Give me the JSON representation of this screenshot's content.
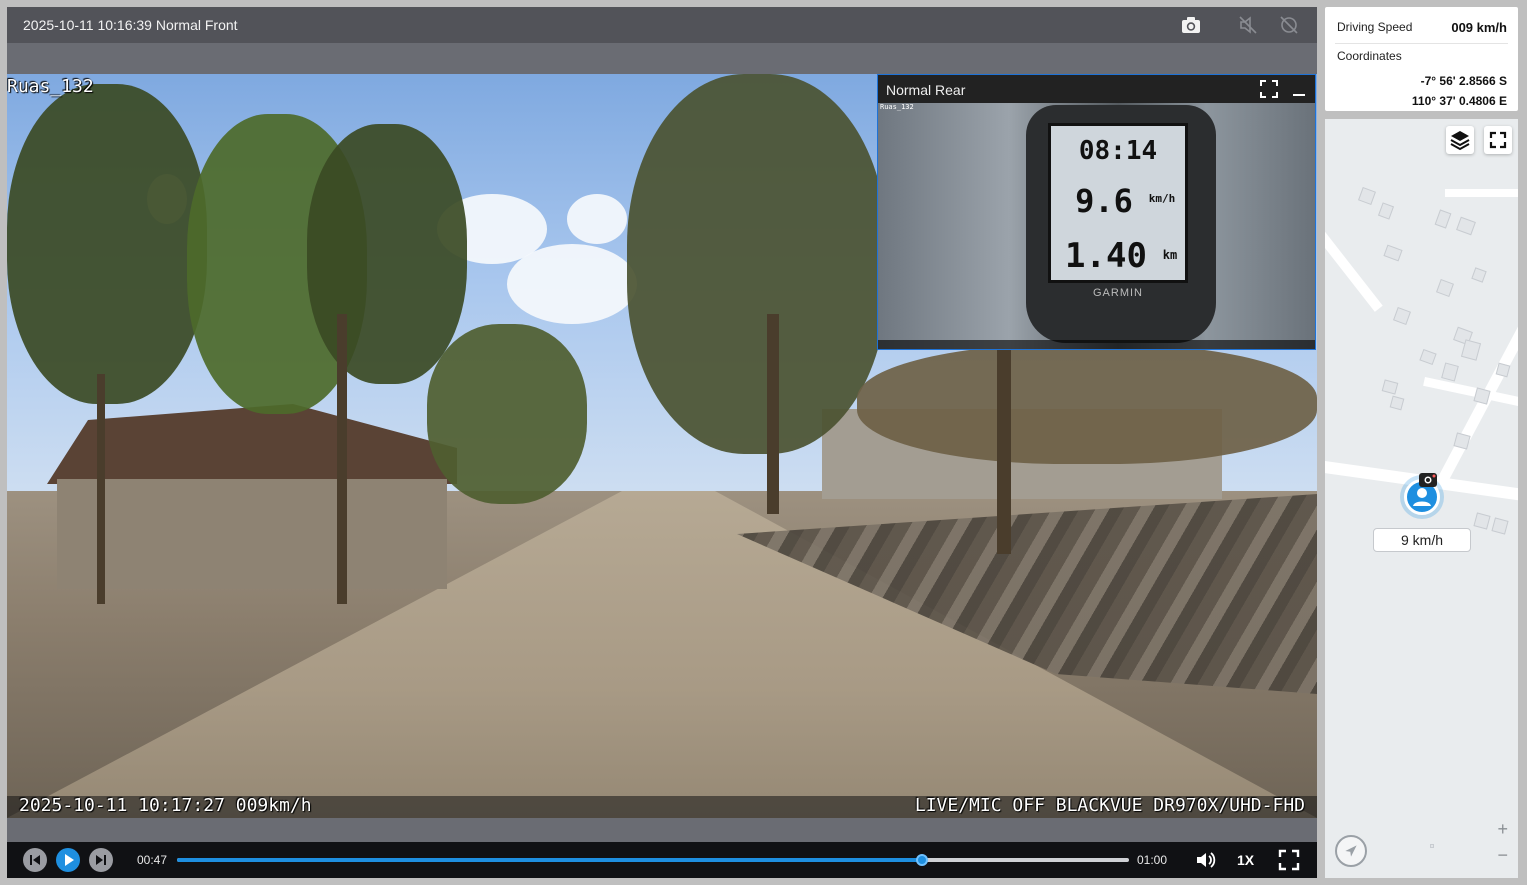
{
  "player": {
    "title": "2025-10-11 10:16:39 Normal Front",
    "icons": [
      "camera-icon",
      "no-audio-icon",
      "no-gps-icon"
    ],
    "osd": {
      "top_left": "Ruas_132",
      "bottom_left": "2025-10-11 10:17:27 009km/h",
      "bottom_right": "LIVE/MIC OFF BLACKVUE DR970X/UHD-FHD"
    },
    "pip": {
      "title": "Normal Rear",
      "osd_top": "Ruas_132",
      "gps": {
        "line1": "08:14",
        "line2": "9.6",
        "line2_unit": "km/h",
        "line3": "1.40",
        "line3_unit": "km",
        "brand": "GARMIN"
      }
    },
    "controls": {
      "current_time": "00:47",
      "total_time": "01:00",
      "progress": 0.783,
      "playback_speed": "1X"
    }
  },
  "info": {
    "speed_label": "Driving Speed",
    "speed_value": "009 km/h",
    "coords_label": "Coordinates",
    "lat": "-7° 56' 2.8566 S",
    "lon": "110° 37' 0.4806 E"
  },
  "map": {
    "speed_chip": "9 km/h",
    "zoom_in": "+",
    "zoom_out": "−"
  },
  "colors": {
    "accent": "#1e8fe0",
    "panel_dark": "#525359",
    "control_bar": "#101114"
  }
}
